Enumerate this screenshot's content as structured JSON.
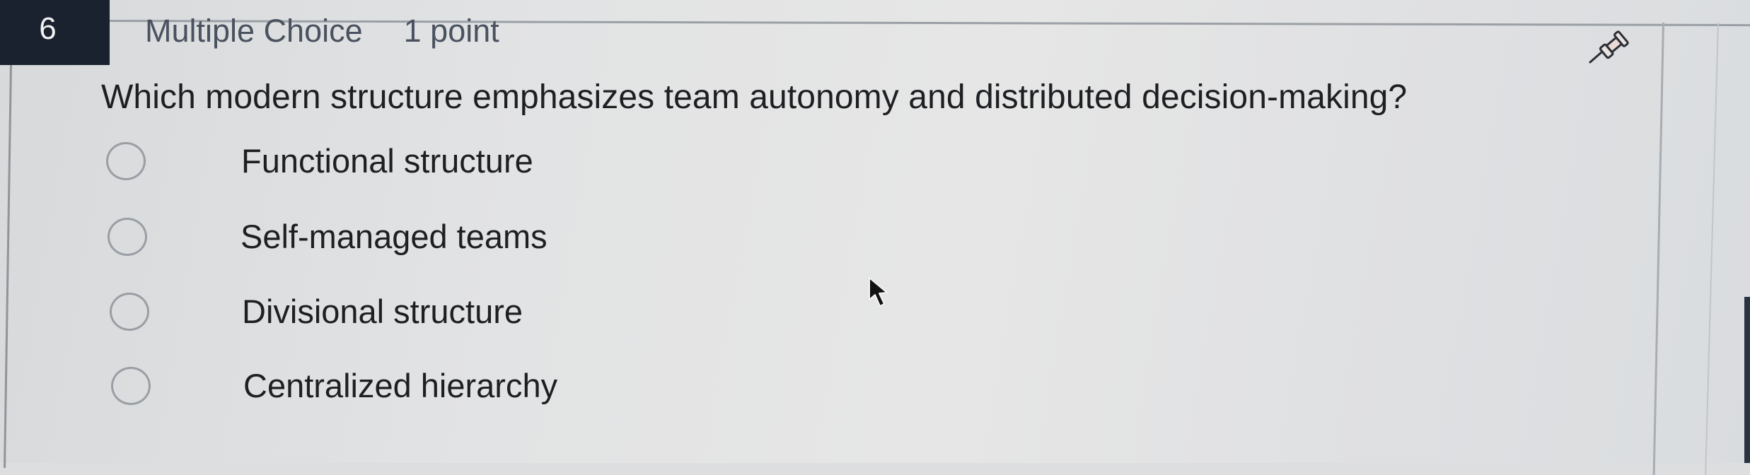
{
  "question": {
    "number": "6",
    "type": "Multiple Choice",
    "points": "1 point",
    "text": "Which modern structure emphasizes team autonomy and distributed decision-making?",
    "options": [
      {
        "label": "Functional structure",
        "selected": false
      },
      {
        "label": "Self-managed teams",
        "selected": false
      },
      {
        "label": "Divisional structure",
        "selected": false
      },
      {
        "label": "Centralized hierarchy",
        "selected": false
      }
    ]
  },
  "icons": {
    "pin": "pushpin-icon",
    "cursor": "mouse-pointer-icon"
  },
  "colors": {
    "badge_bg": "#1a2230",
    "header_text": "#4a5260",
    "body_text": "#1d1f22",
    "radio_border": "#9a9fa5"
  }
}
